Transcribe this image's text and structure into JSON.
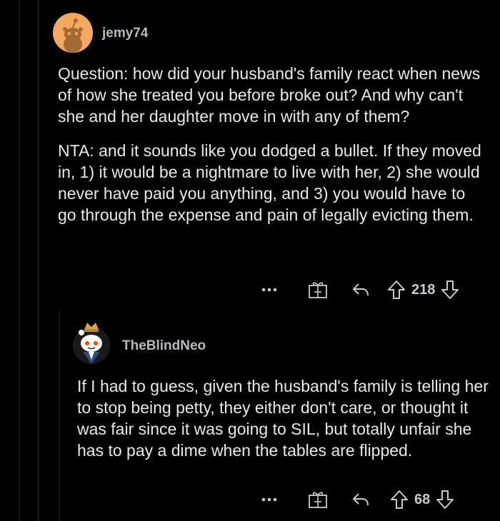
{
  "colors": {
    "background": "#000000",
    "text": "#e8e8e8",
    "username": "#b6b9bb",
    "thread_line": "#2a2a2a",
    "avatar1_bg": "#f3a95f"
  },
  "comments": [
    {
      "username": "jemy74",
      "avatar_icon": "snoo-avatar-icon",
      "paragraphs": [
        "Question:  how did your husband's family react when news of how she treated you before broke out?  And why can't she and her daughter move in with any of them?",
        "NTA: and it sounds like you dodged a bullet.  If they moved in, 1) it would be a nightmare to live with her, 2) she would never have paid you anything, and 3) you would have to go through the expense and pain of legally evicting them."
      ],
      "actions": {
        "more_icon": "more-dots-icon",
        "award_icon": "gift-award-icon",
        "reply_icon": "reply-arrow-icon",
        "upvote_icon": "upvote-arrow-icon",
        "votes": "218",
        "downvote_icon": "downvote-arrow-icon"
      }
    },
    {
      "username": "TheBlindNeo",
      "avatar_icon": "snoo-crowned-avatar-icon",
      "paragraphs": [
        "If I had to guess, given the husband's family is telling her to stop being petty, they either don't care, or thought it was fair since it was going to SIL, but totally unfair she has to pay a dime when the tables are flipped."
      ],
      "actions": {
        "more_icon": "more-dots-icon",
        "award_icon": "gift-award-icon",
        "reply_icon": "reply-arrow-icon",
        "upvote_icon": "upvote-arrow-icon",
        "votes": "68",
        "downvote_icon": "downvote-arrow-icon"
      }
    }
  ]
}
